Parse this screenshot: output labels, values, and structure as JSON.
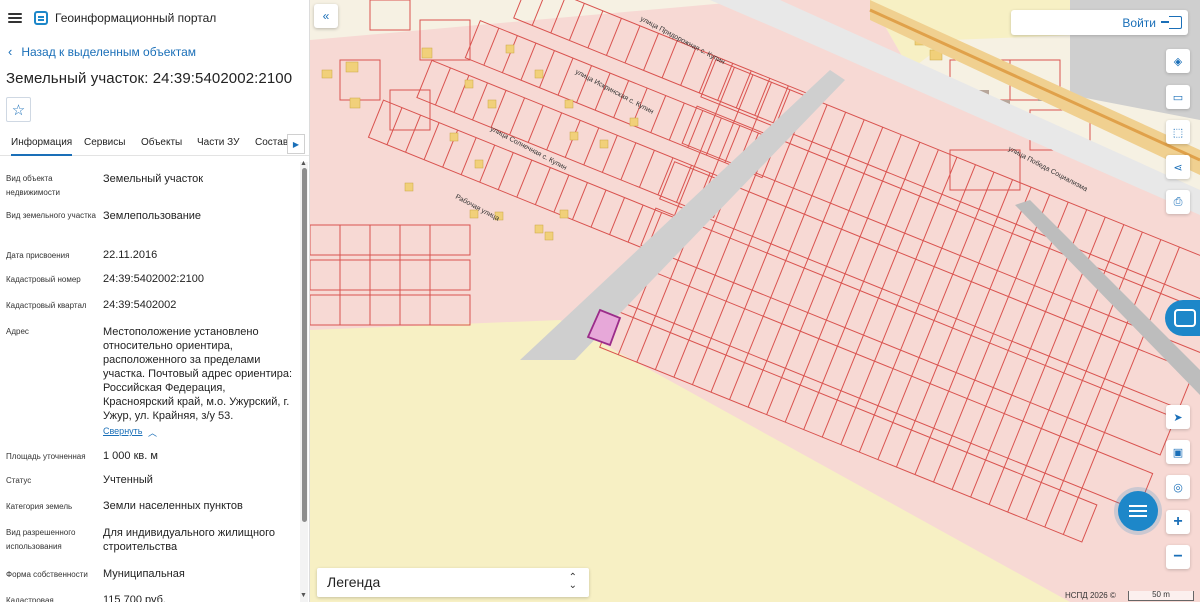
{
  "app": {
    "title": "Геоинформационный портал"
  },
  "nav": {
    "back_label": "Назад к выделенным объектам"
  },
  "object": {
    "title": "Земельный участок: 24:39:5402002:2100"
  },
  "tabs": [
    {
      "label": "Информация",
      "active": true
    },
    {
      "label": "Сервисы"
    },
    {
      "label": "Объекты"
    },
    {
      "label": "Части ЗУ"
    },
    {
      "label": "Состав"
    }
  ],
  "fields": [
    {
      "label": "Вид объекта недвижимости",
      "value": "Земельный участок"
    },
    {
      "label": "Вид земельного участка",
      "value": "Землепользование"
    },
    {
      "label": "Дата присвоения",
      "value": "22.11.2016"
    },
    {
      "label": "Кадастровый номер",
      "value": "24:39:5402002:2100"
    },
    {
      "label": "Кадастровый квартал",
      "value": "24:39:5402002"
    },
    {
      "label": "Адрес",
      "value": "Местоположение установлено относительно ориентира, расположенного за пределами участка. Почтовый адрес ориентира: Российская Федерация, Красноярский край, м.о. Ужурский, г. Ужур, ул. Крайняя, з/у 53."
    },
    {
      "label": "Площадь уточненная",
      "value": "1 000 кв. м"
    },
    {
      "label": "Статус",
      "value": "Учтенный"
    },
    {
      "label": "Категория земель",
      "value": "Земли населенных пунктов"
    },
    {
      "label": "Вид разрешенного использования",
      "value": "Для индивидуального жилищного строительства"
    },
    {
      "label": "Форма собственности",
      "value": "Муниципальная"
    },
    {
      "label": "Кадастровая",
      "value": "115 700 руб."
    }
  ],
  "address_toggle": "Свернуть",
  "map": {
    "login_label": "Войти",
    "legend_label": "Легенда",
    "copyright": "НСПД 2026 ©",
    "scale_label": "50 m",
    "streets": [
      "улица Придорожная с. Купин",
      "улица Искринская с. Купин",
      "улица Солнечная с. Купин",
      "Рабочая улица",
      "улица Победа Социализма"
    ]
  },
  "colors": {
    "accent": "#1a6fb8",
    "parcel_fill": "#f7d9d4",
    "parcel_line": "#d9534f",
    "selected": "#9b2c8a"
  }
}
